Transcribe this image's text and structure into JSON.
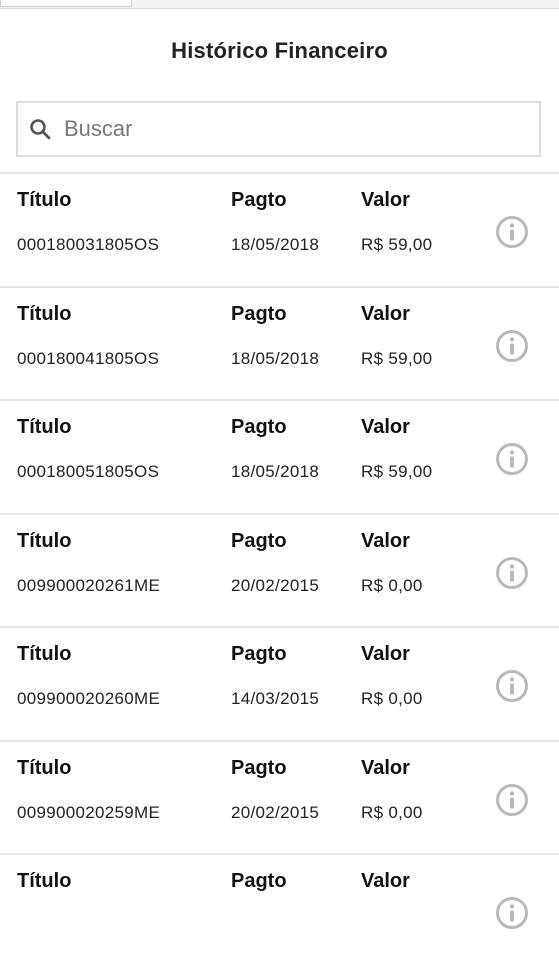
{
  "header": {
    "title": "Histórico Financeiro"
  },
  "search": {
    "placeholder": "Buscar",
    "value": ""
  },
  "columns": {
    "titulo": "Título",
    "pagto": "Pagto",
    "valor": "Valor"
  },
  "rows": [
    {
      "titulo": "000180031805OS",
      "pagto": "18/05/2018",
      "valor": "R$ 59,00"
    },
    {
      "titulo": "000180041805OS",
      "pagto": "18/05/2018",
      "valor": "R$ 59,00"
    },
    {
      "titulo": "000180051805OS",
      "pagto": "18/05/2018",
      "valor": "R$ 59,00"
    },
    {
      "titulo": "009900020261ME",
      "pagto": "20/02/2015",
      "valor": "R$ 0,00"
    },
    {
      "titulo": "009900020260ME",
      "pagto": "14/03/2015",
      "valor": "R$ 0,00"
    },
    {
      "titulo": "009900020259ME",
      "pagto": "20/02/2015",
      "valor": "R$ 0,00"
    },
    {
      "titulo": "",
      "pagto": "",
      "valor": ""
    }
  ],
  "icons": {
    "search": "search-icon",
    "info": "info-icon"
  },
  "colors": {
    "icon_gray": "#b9b9b9",
    "divider": "#e6e6e6",
    "border": "#dcdcdc"
  }
}
